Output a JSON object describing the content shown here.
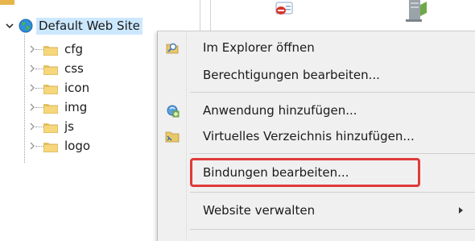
{
  "tree": {
    "root": {
      "label": "Default Web Site",
      "expanded": true,
      "icon": "globe-icon"
    },
    "children": [
      {
        "label": "cfg",
        "icon": "folder-icon"
      },
      {
        "label": "css",
        "icon": "folder-icon"
      },
      {
        "label": "icon",
        "icon": "folder-icon"
      },
      {
        "label": "img",
        "icon": "folder-icon"
      },
      {
        "label": "js",
        "icon": "folder-icon"
      },
      {
        "label": "logo",
        "icon": "folder-icon"
      }
    ]
  },
  "context_menu": {
    "items": [
      {
        "label": "Im Explorer öffnen",
        "icon": "explorer-icon"
      },
      {
        "label": "Berechtigungen bearbeiten...",
        "icon": ""
      },
      {
        "label": "Anwendung hinzufügen...",
        "icon": "add-application-icon"
      },
      {
        "label": "Virtuelles Verzeichnis hinzufügen...",
        "icon": "virtual-directory-icon"
      },
      {
        "label": "Bindungen bearbeiten...",
        "icon": "",
        "highlighted": true
      },
      {
        "label": "Website verwalten",
        "icon": "",
        "has_submenu": true
      }
    ]
  },
  "colors": {
    "selection": "#cce8ff",
    "highlight_border": "#e03a3a",
    "menu_background": "#f0f0f0"
  }
}
